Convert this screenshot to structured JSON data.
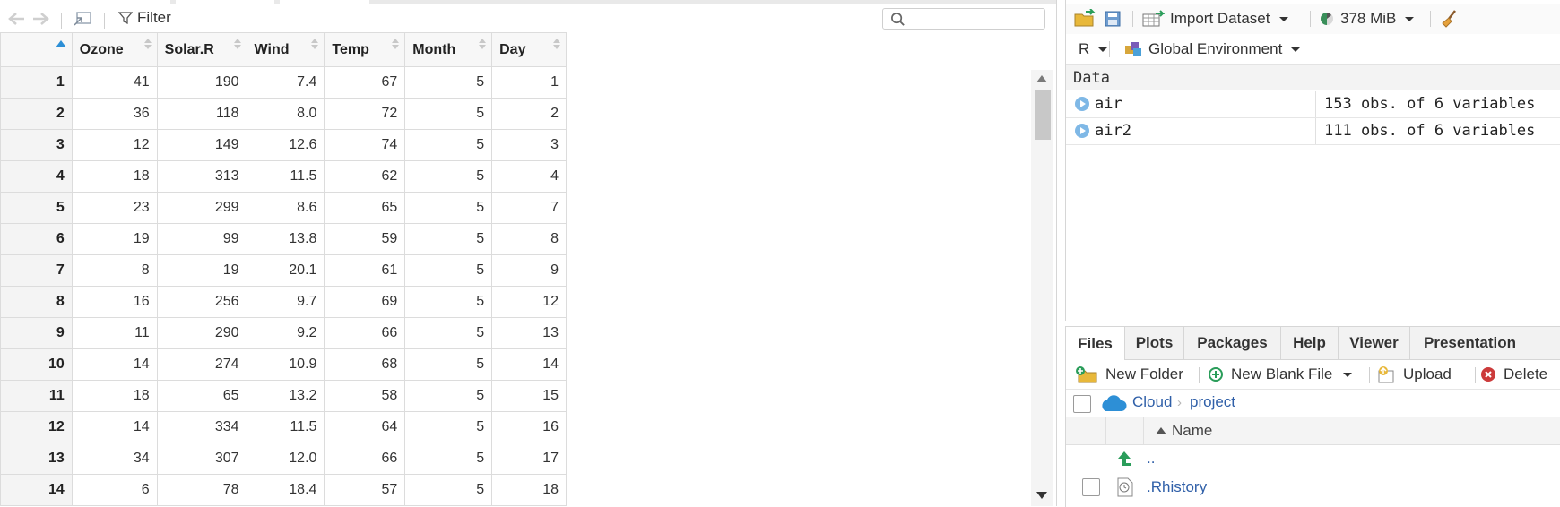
{
  "viewer": {
    "filter_label": "Filter",
    "search_placeholder": "",
    "columns": [
      "Ozone",
      "Solar.R",
      "Wind",
      "Temp",
      "Month",
      "Day"
    ],
    "rows": [
      [
        "1",
        "41",
        "190",
        "7.4",
        "67",
        "5",
        "1"
      ],
      [
        "2",
        "36",
        "118",
        "8.0",
        "72",
        "5",
        "2"
      ],
      [
        "3",
        "12",
        "149",
        "12.6",
        "74",
        "5",
        "3"
      ],
      [
        "4",
        "18",
        "313",
        "11.5",
        "62",
        "5",
        "4"
      ],
      [
        "5",
        "23",
        "299",
        "8.6",
        "65",
        "5",
        "7"
      ],
      [
        "6",
        "19",
        "99",
        "13.8",
        "59",
        "5",
        "8"
      ],
      [
        "7",
        "8",
        "19",
        "20.1",
        "61",
        "5",
        "9"
      ],
      [
        "8",
        "16",
        "256",
        "9.7",
        "69",
        "5",
        "12"
      ],
      [
        "9",
        "11",
        "290",
        "9.2",
        "66",
        "5",
        "13"
      ],
      [
        "10",
        "14",
        "274",
        "10.9",
        "68",
        "5",
        "14"
      ],
      [
        "11",
        "18",
        "65",
        "13.2",
        "58",
        "5",
        "15"
      ],
      [
        "12",
        "14",
        "334",
        "11.5",
        "64",
        "5",
        "16"
      ],
      [
        "13",
        "34",
        "307",
        "12.0",
        "66",
        "5",
        "17"
      ],
      [
        "14",
        "6",
        "78",
        "18.4",
        "57",
        "5",
        "18"
      ]
    ]
  },
  "environment": {
    "import_label": "Import Dataset",
    "memory_label": "378 MiB",
    "language_label": "R",
    "scope_label": "Global Environment",
    "section_label": "Data",
    "objects": [
      {
        "name": "air",
        "value": "153 obs. of 6 variables"
      },
      {
        "name": "air2",
        "value": "111 obs. of 6 variables"
      }
    ]
  },
  "files": {
    "tabs": [
      "Files",
      "Plots",
      "Packages",
      "Help",
      "Viewer",
      "Presentation"
    ],
    "toolbar": {
      "new_folder": "New Folder",
      "new_blank_file": "New Blank File",
      "upload": "Upload",
      "delete": "Delete"
    },
    "breadcrumb": [
      "Cloud",
      "project"
    ],
    "name_header": "Name",
    "entries": [
      {
        "name": ".."
      },
      {
        "name": ".Rhistory"
      }
    ]
  },
  "colors": {
    "accent": "#2d8fd6",
    "link": "#2f5fa8"
  }
}
